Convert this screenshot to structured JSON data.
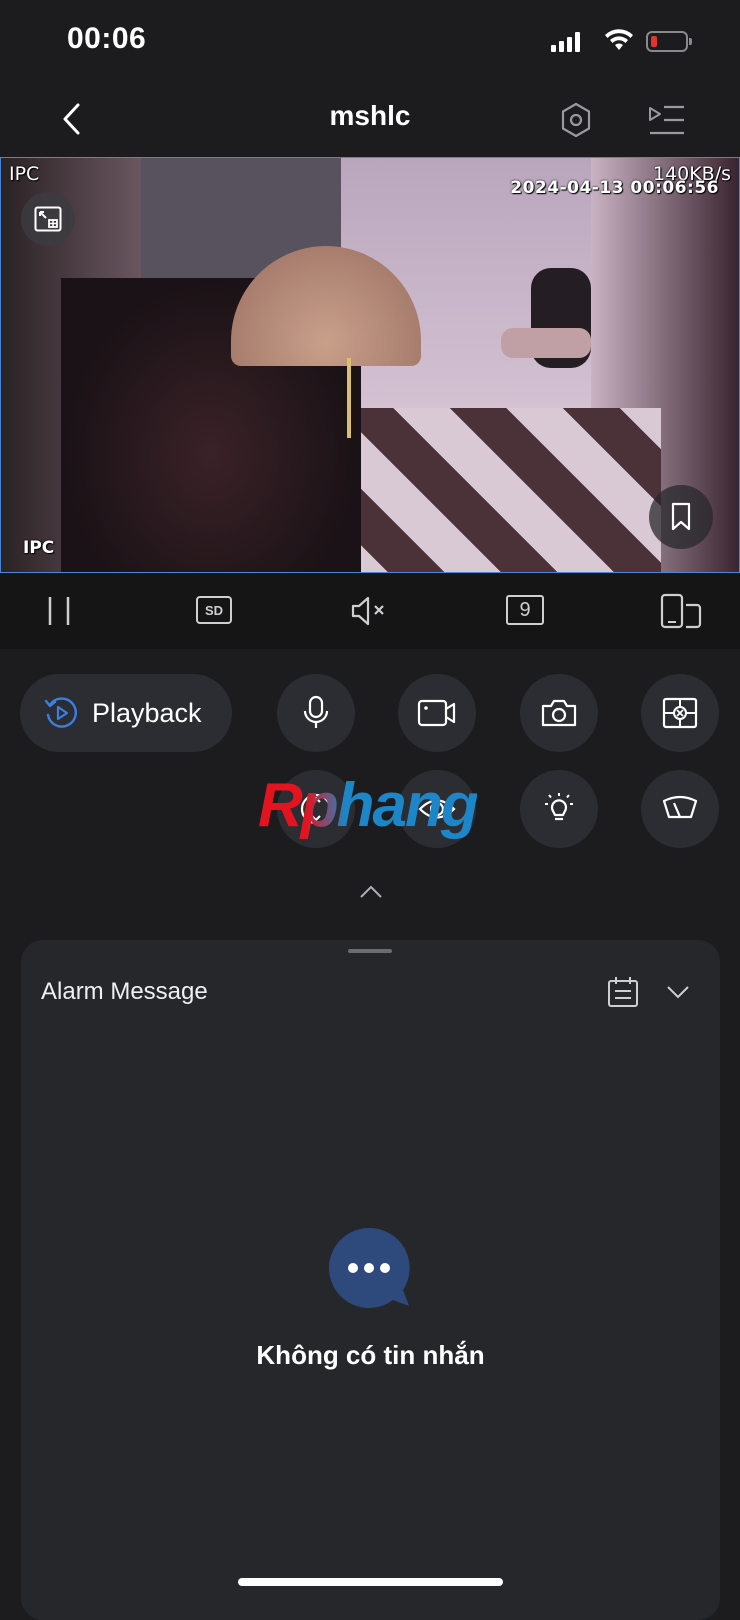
{
  "status_bar": {
    "time": "00:06"
  },
  "nav": {
    "title": "mshlc"
  },
  "video": {
    "label_top": "IPC",
    "bitrate": "140KB/s",
    "timestamp": "2024-04-13 00:06:56",
    "label_bottom": "IPC"
  },
  "toolbar": {
    "sd_label": "SD",
    "split_label": "9"
  },
  "controls": {
    "playback_label": "Playback"
  },
  "watermark": {
    "text": "Rphang"
  },
  "alarm": {
    "title": "Alarm Message",
    "empty_text": "Không có tin nhắn"
  },
  "colors": {
    "accent": "#3b7fe0",
    "background": "#1c1c1e",
    "panel": "#26272b",
    "button": "#2b2d33",
    "battery_low": "#e5322d",
    "chat_icon": "#2e4a7c"
  }
}
